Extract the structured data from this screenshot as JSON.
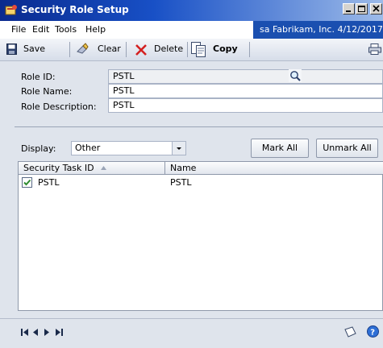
{
  "window": {
    "title": "Security Role Setup"
  },
  "menu": {
    "file": "File",
    "edit": "Edit",
    "tools": "Tools",
    "help": "Help"
  },
  "user_info": "sa  Fabrikam, Inc.  4/12/2017",
  "toolbar": {
    "save": "Save",
    "clear": "Clear",
    "delete": "Delete",
    "copy": "Copy"
  },
  "form": {
    "role_id_label": "Role ID:",
    "role_id_value": "PSTL",
    "role_name_label": "Role Name:",
    "role_name_value": "PSTL",
    "role_desc_label": "Role Description:",
    "role_desc_value": "PSTL"
  },
  "display": {
    "label": "Display:",
    "selected": "Other",
    "mark_all": "Mark All",
    "unmark_all": "Unmark All"
  },
  "grid": {
    "columns": [
      "Security Task ID",
      "Name"
    ],
    "rows": [
      {
        "checked": true,
        "task_id": "PSTL",
        "name": "PSTL"
      }
    ]
  },
  "colors": {
    "title_start": "#0a2a8e",
    "title_end": "#9dbbe9",
    "accent": "#1a4fb0",
    "check": "#2e8b2e"
  }
}
